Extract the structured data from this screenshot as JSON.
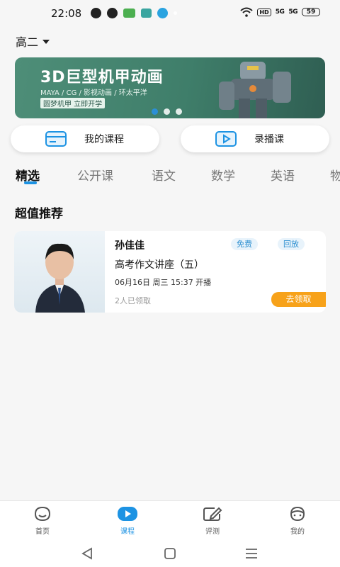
{
  "status_bar": {
    "time": "22:08",
    "hd": "HD",
    "sig1": "5G",
    "sig2": "5G",
    "battery": "59",
    "icons": [
      "message-icon",
      "navigation-icon",
      "wechat-icon",
      "app-icon",
      "telegram-icon",
      "dot-icon"
    ]
  },
  "header": {
    "grade": "高二"
  },
  "banner": {
    "title": "3D巨型机甲动画",
    "subtitle": "MAYA / CG / 影视动画 / 环太平洋",
    "tag": "圆梦机甲 立即开学",
    "slide_count": 3,
    "active_slide": 0
  },
  "quick_actions": [
    {
      "label": "我的课程",
      "icon": "card-icon"
    },
    {
      "label": "录播课",
      "icon": "play-icon"
    }
  ],
  "tabs": [
    "精选",
    "公开课",
    "语文",
    "数学",
    "英语",
    "物"
  ],
  "active_tab": 0,
  "section": {
    "title": "超值推荐"
  },
  "course": {
    "teacher": "孙佳佳",
    "badges": [
      "免费",
      "回放"
    ],
    "title": "高考作文讲座（五）",
    "time": "06月16日 周三 15:37 开播",
    "claimed": "2人已领取",
    "cta": "去领取"
  },
  "bottom_nav": [
    {
      "label": "首页",
      "icon": "home-face-icon",
      "active": false
    },
    {
      "label": "课程",
      "icon": "course-play-icon",
      "active": true
    },
    {
      "label": "评测",
      "icon": "edit-icon",
      "active": false
    },
    {
      "label": "我的",
      "icon": "profile-icon",
      "active": false
    }
  ],
  "colors": {
    "accent": "#1d93e3",
    "cta": "#f7a21a",
    "banner": "#4e8e78"
  }
}
